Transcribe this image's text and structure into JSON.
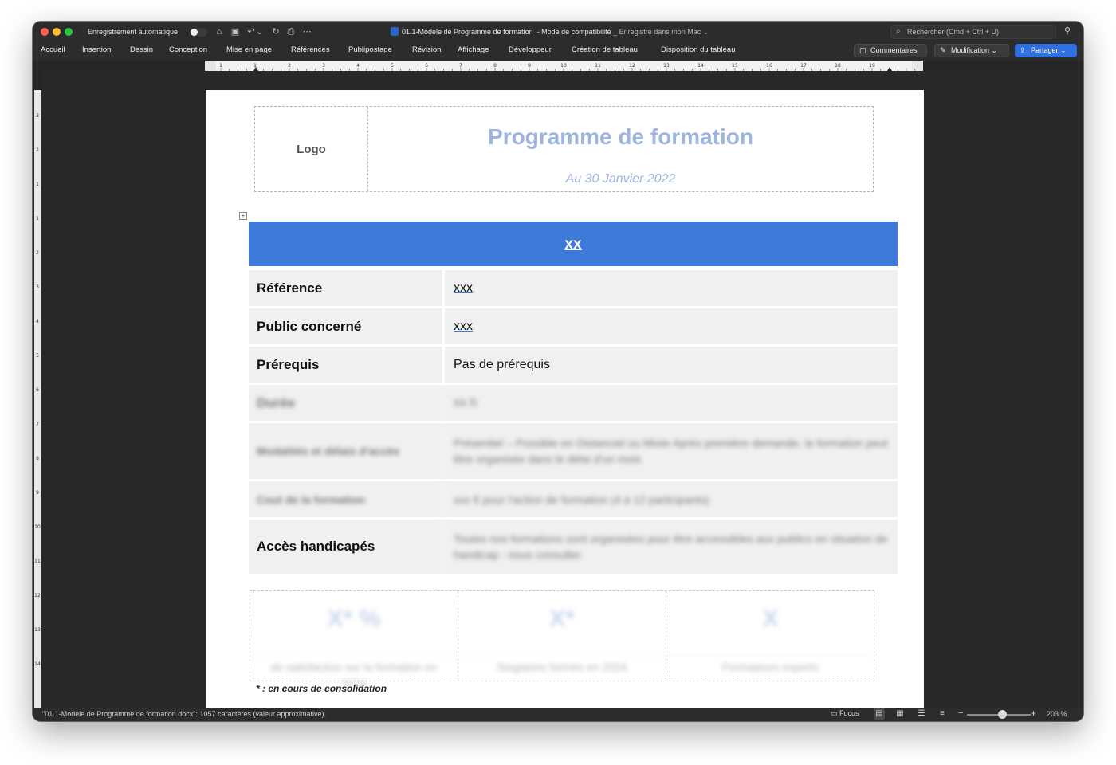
{
  "window": {
    "autosave_label": "Enregistrement automatique",
    "title_doc": "01.1-Modele de Programme de formation",
    "title_mode": "-  Mode de compatibilité",
    "title_saved": "_ Enregistré dans mon Mac ⌄",
    "search_placeholder": "Rechercher (Cmd + Ctrl + U)"
  },
  "ribbon": {
    "tabs": [
      "Accueil",
      "Insertion",
      "Dessin",
      "Conception",
      "Mise en page",
      "Références",
      "Publipostage",
      "Révision",
      "Affichage",
      "Développeur",
      "Création de tableau",
      "Disposition du tableau"
    ],
    "comments_label": "Commentaires",
    "edit_label": "Modification ⌄",
    "share_label": "Partager ⌄"
  },
  "ruler": {
    "h_numbers": [
      "1",
      "1",
      "2",
      "3",
      "4",
      "5",
      "6",
      "7",
      "8",
      "9",
      "10",
      "11",
      "12",
      "13",
      "14",
      "15",
      "16",
      "17",
      "18",
      "19"
    ],
    "v_numbers": [
      "3",
      "2",
      "1",
      "1",
      "2",
      "3",
      "4",
      "5",
      "6",
      "7",
      "8",
      "9",
      "10",
      "11",
      "12",
      "13",
      "14"
    ]
  },
  "document": {
    "header": {
      "logo": "Logo",
      "title": "Programme de formation",
      "date": "Au 30 Janvier 2022"
    },
    "banner": "xx",
    "rows": [
      {
        "label": "Référence",
        "value": "xxx"
      },
      {
        "label": "Public concerné",
        "value": "xxx"
      },
      {
        "label": "Prérequis",
        "value": "Pas de prérequis"
      },
      {
        "label": "Durée",
        "value": "xx h"
      },
      {
        "label": "Modalités et délais d'accès",
        "value": "Présentiel – Possible en Distanciel ou Mixte Après première demande, la formation peut être organisée dans le délai d'un mois"
      },
      {
        "label": "Cout de la formation",
        "value": "xxx € pour l'action de formation (4 à 12 participants)"
      },
      {
        "label": "Accès handicapés",
        "value": "Toutes nos formations sont organisées pour être accessibles aux publics en situation de handicap : nous consulter."
      }
    ],
    "stats": [
      {
        "value": "X* %",
        "caption": "de satisfaction sur la formation en 2024"
      },
      {
        "value": "X*",
        "caption": "Stagiaires formés en 2024"
      },
      {
        "value": "X",
        "caption": "Formateurs experts"
      }
    ],
    "footnote": "* : en cours de consolidation"
  },
  "status": {
    "text": "\"01.1-Modele de Programme de formation.docx\": 1057 caractères (valeur approximative).",
    "focus": "Focus",
    "zoom": "203 %"
  },
  "colors": {
    "banner": "#3e7ad9",
    "title": "#9db4de",
    "share_button": "#2f6fe0"
  }
}
